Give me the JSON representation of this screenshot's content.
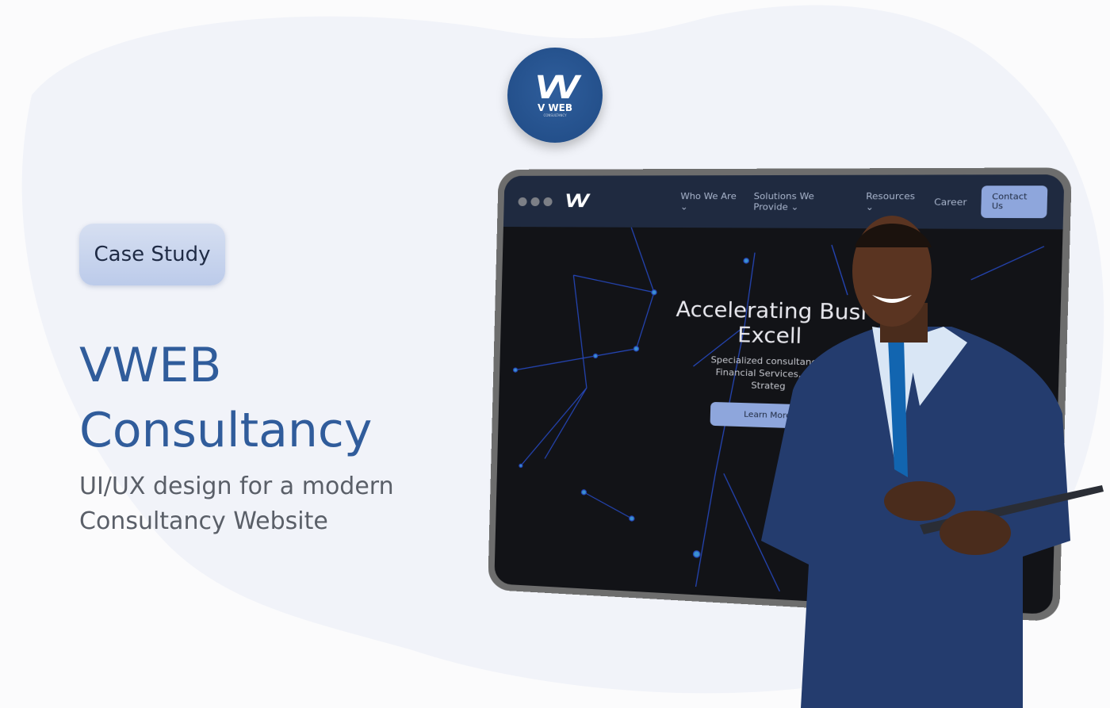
{
  "badge": "Case Study",
  "title_line1": "VWEB",
  "title_line2": "Consultancy",
  "subtitle_line1": "UI/UX design for a modern",
  "subtitle_line2": "Consultancy Website",
  "logo": {
    "mark": "VV",
    "name": "V WEB",
    "tagline": "CONSULTANCY"
  },
  "mockup": {
    "logo": "VV",
    "nav": [
      "Who We Are ⌄",
      "Solutions We Provide ⌄",
      "Resources ⌄",
      "Career"
    ],
    "contact": "Contact Us",
    "hero_line1": "Accelerating Busi",
    "hero_line2": "Excell",
    "desc1": "Specialized consultancy i",
    "desc2": "Financial Services, Reg",
    "desc3": "Strateg",
    "cta": "Learn More"
  },
  "colors": {
    "accent": "#305c9b",
    "navy": "#1f2a40",
    "button": "#8ea6dc"
  }
}
